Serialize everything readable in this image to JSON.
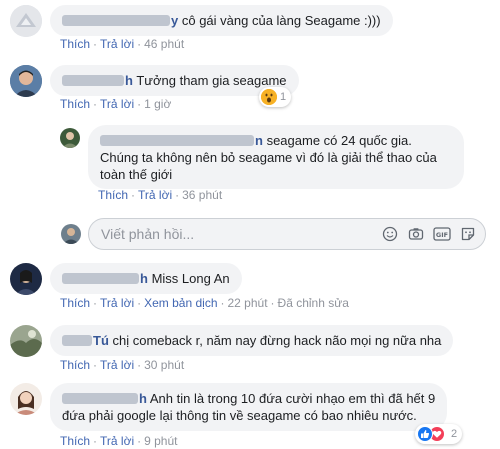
{
  "comments": [
    {
      "name_suffix": "y",
      "text": "cô gái vàng của làng Seagame :)))",
      "actions": {
        "like": "Thích",
        "reply": "Trả lời",
        "time": "46 phút"
      }
    },
    {
      "name_suffix": "h",
      "text": "Tưởng tham gia seagame",
      "actions": {
        "like": "Thích",
        "reply": "Trả lời",
        "time": "1 giờ"
      },
      "reaction": {
        "emoji": "wow",
        "count": "1"
      }
    },
    {
      "name_suffix": "n",
      "text": "seagame có 24 quốc gia.",
      "text2": "Chúng ta không nên bỏ seagame vì đó là giải thể thao của",
      "text3": "toàn thế giới",
      "actions": {
        "like": "Thích",
        "reply": "Trả lời",
        "time": "36 phút"
      }
    },
    {
      "name_suffix": "h",
      "text": "Miss Long An",
      "actions": {
        "like": "Thích",
        "reply": "Trả lời",
        "translate": "Xem bản dịch",
        "time": "22 phút",
        "edited": "Đã chỉnh sửa"
      }
    },
    {
      "name_suffix": "Tú",
      "text": "chị comeback r, năm nay đừng hack não mọi ng nữa nha",
      "actions": {
        "like": "Thích",
        "reply": "Trả lời",
        "time": "30 phút"
      }
    },
    {
      "name_suffix": "h",
      "text": "Anh tin là trong 10 đứa cười nhạo em thì đã hết 9",
      "text2": "đứa phải google lại thông tin về seagame có bao nhiêu nước.",
      "actions": {
        "like": "Thích",
        "reply": "Trả lời",
        "time": "9 phút"
      },
      "reaction": {
        "emoji": "like-love",
        "count": "2"
      }
    }
  ],
  "reply_box": {
    "placeholder": "Viết phản hồi..."
  },
  "colors": {
    "link": "#4267b2",
    "meta": "#90949c",
    "bubble": "#f2f3f5",
    "name": "#385898"
  },
  "icons": [
    "emoji-icon",
    "camera-icon",
    "gif-icon",
    "sticker-icon",
    "wow-emoji-icon",
    "like-icon",
    "love-icon"
  ]
}
